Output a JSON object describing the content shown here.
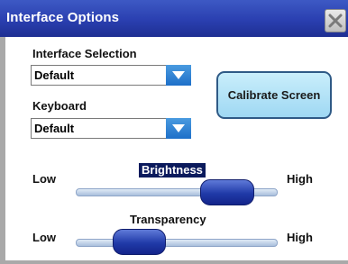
{
  "window": {
    "title": "Interface Options"
  },
  "interface_selection": {
    "label": "Interface Selection",
    "value": "Default"
  },
  "keyboard": {
    "label": "Keyboard",
    "value": "Default"
  },
  "calibrate": {
    "label": "Calibrate Screen"
  },
  "brightness": {
    "label": "Brightness",
    "low": "Low",
    "high": "High",
    "level": 0.85
  },
  "transparency": {
    "label": "Transparency",
    "low": "Low",
    "high": "High",
    "level": 0.25
  },
  "colors": {
    "titlebar": "#2a3fb0",
    "accent": "#1d6fc9",
    "slider_thumb": "#203aa8"
  },
  "icons": {
    "close": "close-icon",
    "dropdown": "chevron-down-icon"
  }
}
